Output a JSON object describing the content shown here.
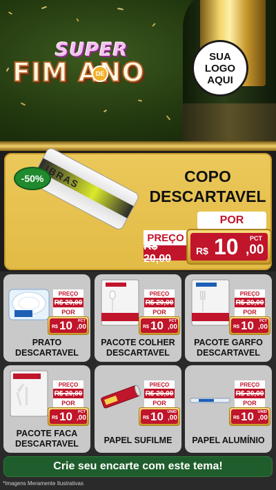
{
  "header": {
    "title_top": "SUPER",
    "title_main": "FIM ANO",
    "title_connector": "DE",
    "logo_lines": [
      "SUA",
      "LOGO",
      "AQUI"
    ]
  },
  "featured": {
    "discount_badge": "-50%",
    "product_label": "IBRAS",
    "title_lines": [
      "COPO",
      "DESCARTAVEL"
    ],
    "old_price_label": "PREÇO",
    "old_price": "R$ 20,00",
    "new_price_label": "POR",
    "currency": "R$",
    "price_int": "10",
    "price_dec": ",00",
    "unit": "PCT"
  },
  "products": [
    {
      "name_lines": [
        "PRATO",
        "DESCARTAVEL"
      ],
      "old_label": "PREÇO",
      "old_price": "R$ 20,00",
      "new_label": "POR",
      "currency": "R$",
      "price_int": "10",
      "price_dec": ",00",
      "unit": "PCT",
      "icon": "plate-pack-icon"
    },
    {
      "name_lines": [
        "PACOTE COLHER",
        "DESCARTAVEL"
      ],
      "old_label": "PREÇO",
      "old_price": "R$ 20,00",
      "new_label": "POR",
      "currency": "R$",
      "price_int": "10",
      "price_dec": ",00",
      "unit": "PCT",
      "icon": "spoon-pack-icon"
    },
    {
      "name_lines": [
        "PACOTE GARFO",
        "DESCARTAVEL"
      ],
      "old_label": "PREÇO",
      "old_price": "R$ 20,00",
      "new_label": "POR",
      "currency": "R$",
      "price_int": "10",
      "price_dec": ",00",
      "unit": "PCT",
      "icon": "fork-pack-icon"
    },
    {
      "name_lines": [
        "PACOTE FACA",
        "DESCARTAVEL"
      ],
      "old_label": "PREÇO",
      "old_price": "R$ 20,00",
      "new_label": "POR",
      "currency": "R$",
      "price_int": "10",
      "price_dec": ",00",
      "unit": "PCT",
      "icon": "knife-pack-icon"
    },
    {
      "name_lines": [
        "PAPEL SUFILME"
      ],
      "old_label": "PREÇO",
      "old_price": "R$ 20,00",
      "new_label": "POR",
      "currency": "R$",
      "price_int": "10",
      "price_dec": ",00",
      "unit": "UNID",
      "icon": "plastic-wrap-roll-icon"
    },
    {
      "name_lines": [
        "PAPEL ALUMÍNIO"
      ],
      "old_label": "PREÇO",
      "old_price": "R$ 20,00",
      "new_label": "POR",
      "currency": "R$",
      "price_int": "10",
      "price_dec": ",00",
      "unit": "UNID",
      "icon": "aluminum-foil-roll-icon"
    }
  ],
  "cta_label": "Crie seu encarte com este tema!",
  "footnote": "*Imagens Meramente Ilustrativas",
  "colors": {
    "brand_red": "#c0152a",
    "gold": "#e2bb45",
    "green_cta": "#1f5e2c",
    "badge_green": "#1f8a2e"
  }
}
